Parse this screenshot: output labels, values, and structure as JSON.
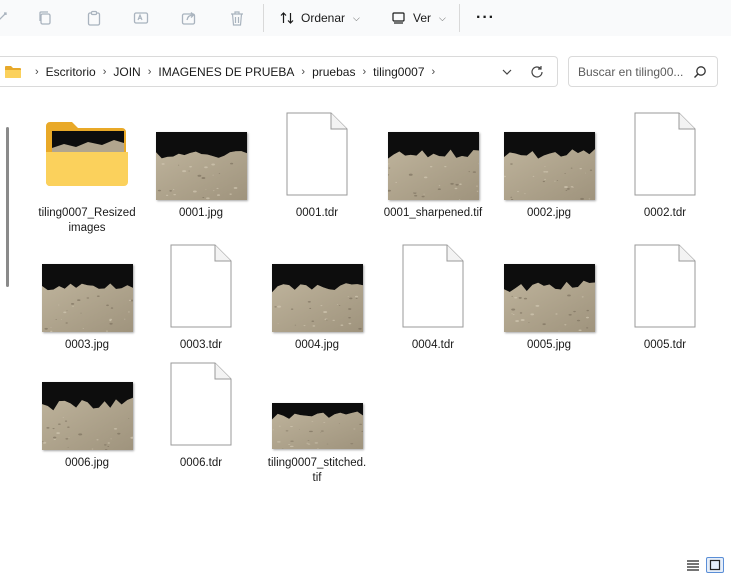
{
  "toolbar": {
    "sort_label": "Ordenar",
    "view_label": "Ver",
    "more_label": "···"
  },
  "breadcrumb": [
    "Escritorio",
    "JOIN",
    "IMAGENES DE PRUEBA",
    "pruebas",
    "tiling0007"
  ],
  "search": {
    "placeholder": "Buscar en tiling00..."
  },
  "files": [
    {
      "name": "tiling0007_Resized images",
      "type": "folder"
    },
    {
      "name": "0001.jpg",
      "type": "image"
    },
    {
      "name": "0001.tdr",
      "type": "document"
    },
    {
      "name": "0001_sharpened.tif",
      "type": "image"
    },
    {
      "name": "0002.jpg",
      "type": "image"
    },
    {
      "name": "0002.tdr",
      "type": "document"
    },
    {
      "name": "0003.jpg",
      "type": "image"
    },
    {
      "name": "0003.tdr",
      "type": "document"
    },
    {
      "name": "0004.jpg",
      "type": "image"
    },
    {
      "name": "0004.tdr",
      "type": "document"
    },
    {
      "name": "0005.jpg",
      "type": "image"
    },
    {
      "name": "0005.tdr",
      "type": "document"
    },
    {
      "name": "0006.jpg",
      "type": "image"
    },
    {
      "name": "0006.tdr",
      "type": "document"
    },
    {
      "name": "tiling0007_stitched.tif",
      "type": "image"
    }
  ],
  "colors": {
    "accent": "#0067c0",
    "folder": "#f8c74d",
    "rock": "#b2a690"
  }
}
